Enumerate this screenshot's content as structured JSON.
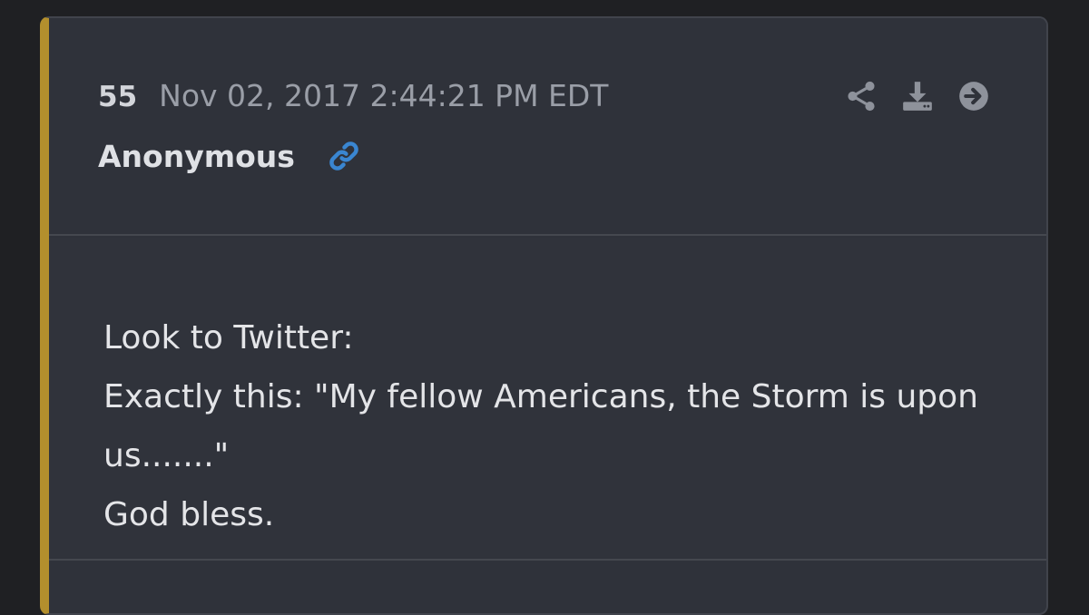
{
  "post": {
    "number": "55",
    "timestamp": "Nov 02, 2017 2:44:21 PM EDT",
    "author": "Anonymous",
    "accent_color": "#b38f2d",
    "link_icon_color": "#3a86d1",
    "actions": [
      {
        "icon": "share-icon"
      },
      {
        "icon": "download-icon"
      },
      {
        "icon": "arrow-right-circle-icon"
      }
    ],
    "message_lines": [
      "Look to Twitter:",
      "Exactly this: \"My fellow Americans, the Storm is upon",
      "us.......\"",
      "God bless."
    ]
  }
}
